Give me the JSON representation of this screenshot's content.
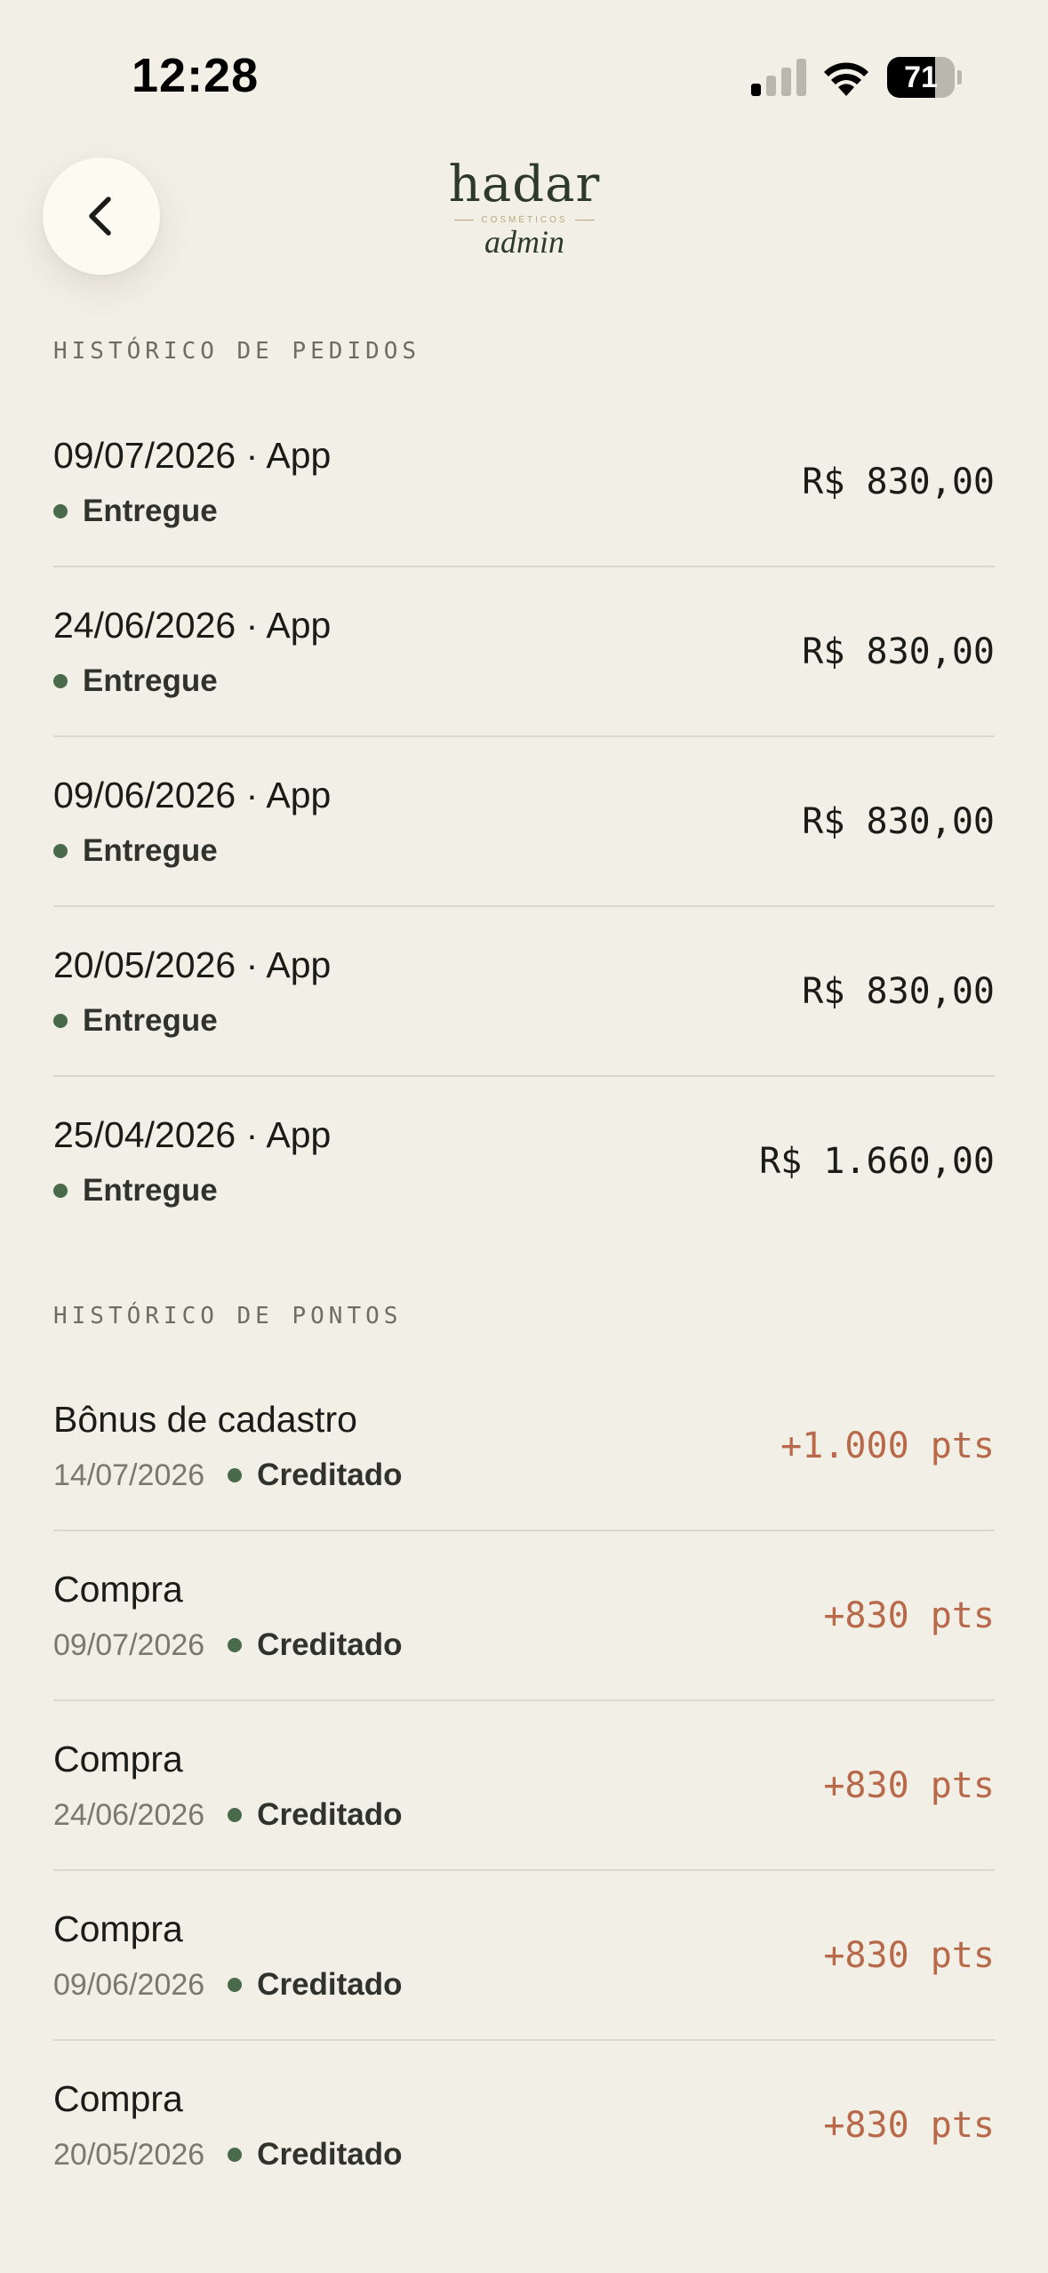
{
  "status_bar": {
    "time": "12:28",
    "battery_level": "71",
    "battery_fraction": 0.71,
    "icons": [
      "cellular-signal-icon",
      "wifi-icon",
      "battery-icon"
    ]
  },
  "header": {
    "back_icon": "chevron-left-icon",
    "brand_name": "hadar",
    "brand_tagline": "COSMÉTICOS",
    "brand_sub": "admin"
  },
  "orders": {
    "title": "HISTÓRICO DE PEDIDOS",
    "items": [
      {
        "title": "09/07/2026 · App",
        "status": "Entregue",
        "amount": "R$ 830,00"
      },
      {
        "title": "24/06/2026 · App",
        "status": "Entregue",
        "amount": "R$ 830,00"
      },
      {
        "title": "09/06/2026 · App",
        "status": "Entregue",
        "amount": "R$ 830,00"
      },
      {
        "title": "20/05/2026 · App",
        "status": "Entregue",
        "amount": "R$ 830,00"
      },
      {
        "title": "25/04/2026 · App",
        "status": "Entregue",
        "amount": "R$ 1.660,00"
      }
    ]
  },
  "points": {
    "title": "HISTÓRICO DE PONTOS",
    "items": [
      {
        "title": "Bônus de cadastro",
        "date": "14/07/2026",
        "status": "Creditado",
        "points": "+1.000 pts"
      },
      {
        "title": "Compra",
        "date": "09/07/2026",
        "status": "Creditado",
        "points": "+830 pts"
      },
      {
        "title": "Compra",
        "date": "24/06/2026",
        "status": "Creditado",
        "points": "+830 pts"
      },
      {
        "title": "Compra",
        "date": "09/06/2026",
        "status": "Creditado",
        "points": "+830 pts"
      },
      {
        "title": "Compra",
        "date": "20/05/2026",
        "status": "Creditado",
        "points": "+830 pts"
      }
    ]
  },
  "colors": {
    "background": "#f2efe6",
    "status_green": "#4a6b4b",
    "points_accent": "#b8694a",
    "brand_green": "#2d3a2a"
  }
}
